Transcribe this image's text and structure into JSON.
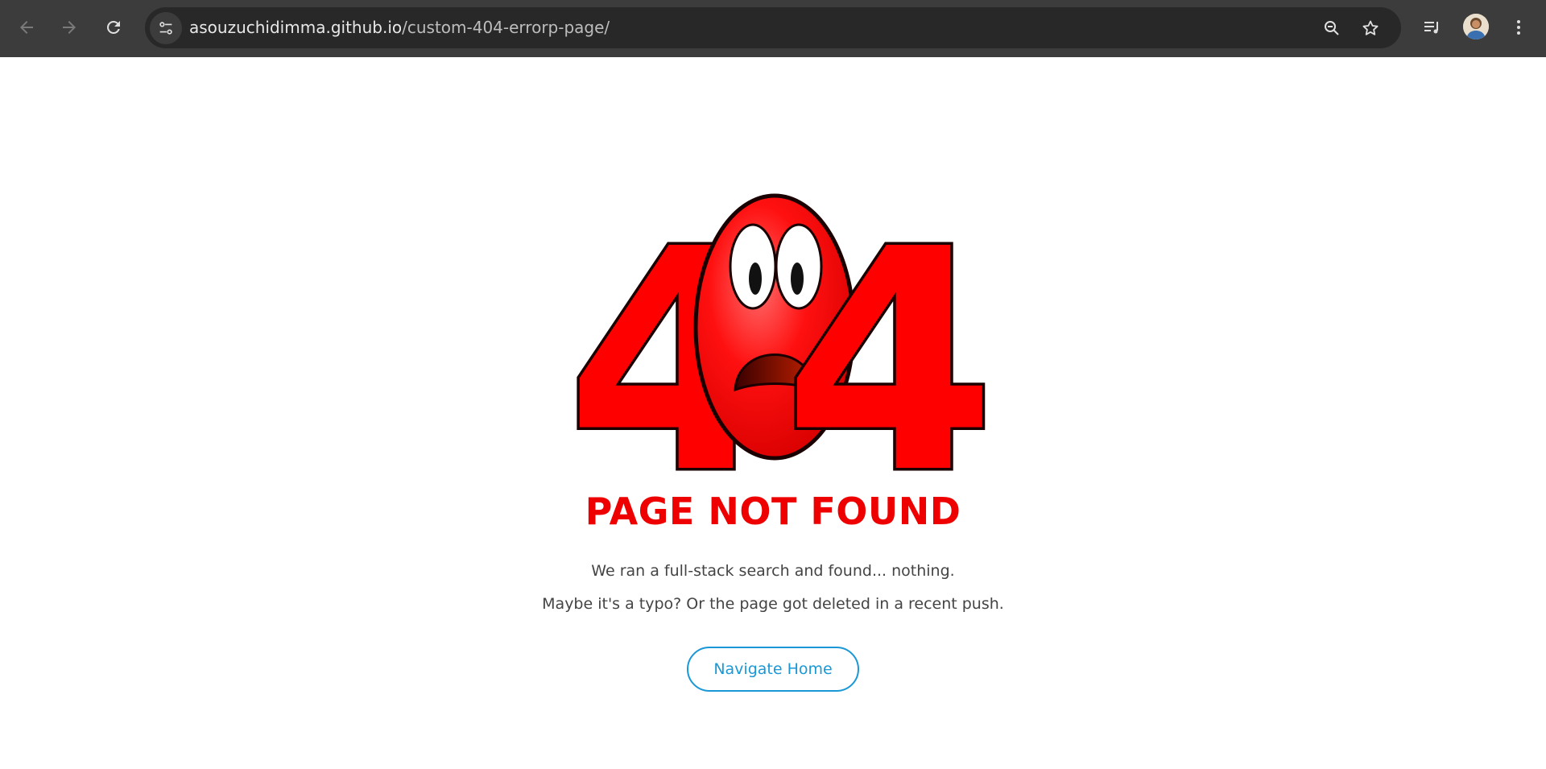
{
  "browser": {
    "url_host": "asouzuchidimma.github.io",
    "url_path": "/custom-404-errorp-page/",
    "icons": [
      "back-icon",
      "forward-icon",
      "reload-icon",
      "site-info-icon",
      "zoom-icon",
      "bookmark-star-icon",
      "media-control-icon",
      "profile-avatar",
      "more-menu-icon"
    ]
  },
  "hero": {
    "digits": [
      "4",
      "4"
    ],
    "icon": "scared-face-icon"
  },
  "content": {
    "title": "PAGE NOT FOUND",
    "line1": "We ran a full-stack search and found... nothing.",
    "line2": "Maybe it's a typo? Or the page got deleted in a recent push.",
    "button_label": "Navigate Home"
  },
  "colors": {
    "accent_red": "#ee0000",
    "button_blue": "#1a98d6",
    "chrome_bg": "#3c3c3c"
  }
}
